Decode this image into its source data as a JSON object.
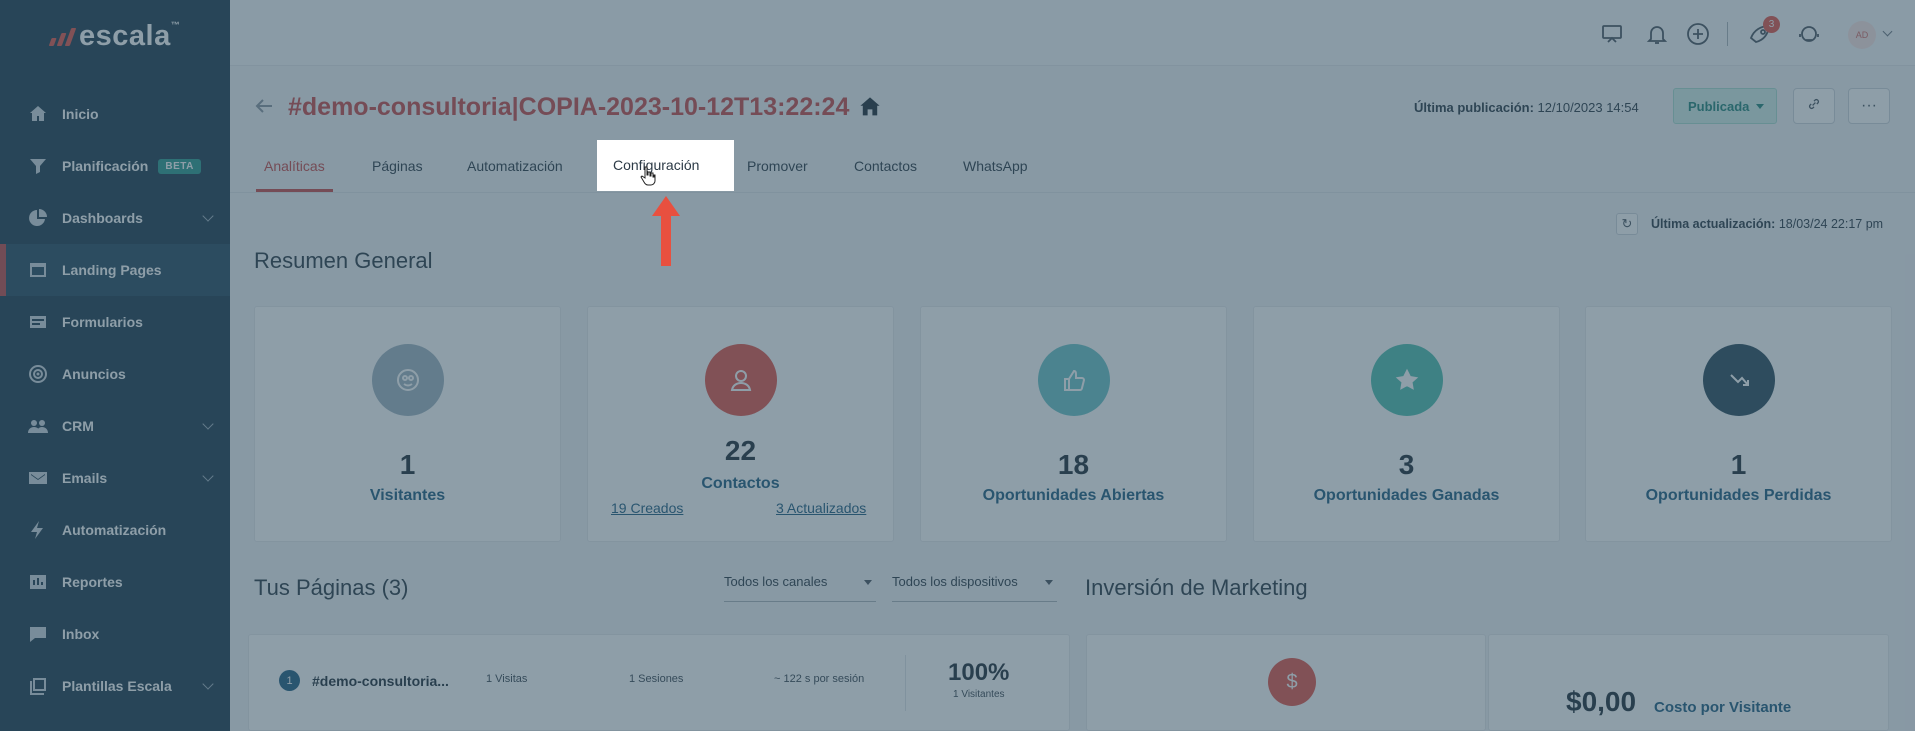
{
  "brand": {
    "name": "escala",
    "mark": "™"
  },
  "sidebar": {
    "items": [
      {
        "label": "Inicio",
        "icon": "home-icon"
      },
      {
        "label": "Planificación",
        "icon": "filter-icon",
        "badge": "BETA"
      },
      {
        "label": "Dashboards",
        "icon": "pie-chart-icon",
        "has_chevron": true
      },
      {
        "label": "Landing Pages",
        "icon": "window-icon",
        "active": true
      },
      {
        "label": "Formularios",
        "icon": "form-icon"
      },
      {
        "label": "Anuncios",
        "icon": "target-icon"
      },
      {
        "label": "CRM",
        "icon": "users-icon",
        "has_chevron": true
      },
      {
        "label": "Emails",
        "icon": "mail-icon",
        "has_chevron": true
      },
      {
        "label": "Automatización",
        "icon": "bolt-icon"
      },
      {
        "label": "Reportes",
        "icon": "report-icon"
      },
      {
        "label": "Inbox",
        "icon": "chat-icon"
      },
      {
        "label": "Plantillas Escala",
        "icon": "template-icon",
        "has_chevron": true
      }
    ]
  },
  "topbar": {
    "notification_count": "3",
    "avatar_initials": "AD",
    "icons": [
      "presentation-icon",
      "bell-icon",
      "plus-circle-icon",
      "rocket-icon",
      "support-icon"
    ]
  },
  "header": {
    "title": "#demo-consultoria|COPIA-2023-10-12T13:22:24",
    "last_publish_label": "Última publicación:",
    "last_publish_value": "12/10/2023 14:54",
    "status_button": "Publicada",
    "more_label": "···"
  },
  "tabs": [
    {
      "label": "Analíticas",
      "active": true
    },
    {
      "label": "Páginas"
    },
    {
      "label": "Automatización"
    },
    {
      "label": "Configuración",
      "highlighted": true
    },
    {
      "label": "Promover"
    },
    {
      "label": "Contactos"
    },
    {
      "label": "WhatsApp"
    }
  ],
  "update": {
    "label": "Última actualización:",
    "value": "18/03/24 22:17 pm"
  },
  "summary": {
    "title": "Resumen General",
    "cards": [
      {
        "value": "1",
        "label": "Visitantes",
        "color": "#9fb4c1",
        "icon": "eye-icon"
      },
      {
        "value": "22",
        "label": "Contactos",
        "color": "#e2544b",
        "icon": "user-icon",
        "link_left": "19 Creados",
        "link_right": "3 Actualizados"
      },
      {
        "value": "18",
        "label": "Oportunidades Abiertas",
        "color": "#6cc3c8",
        "icon": "thumbs-up-icon"
      },
      {
        "value": "3",
        "label": "Oportunidades Ganadas",
        "color": "#4fbfb0",
        "icon": "star-icon"
      },
      {
        "value": "1",
        "label": "Oportunidades Perdidas",
        "color": "#2b4a5c",
        "icon": "trend-down-icon"
      }
    ]
  },
  "pages": {
    "title": "Tus Páginas (3)",
    "filter_channels": "Todos los canales",
    "filter_devices": "Todos los dispositivos",
    "rows": [
      {
        "index": "1",
        "name": "#demo-consultoria...",
        "visits": "1 Visitas",
        "sessions": "1 Sesiones",
        "time": "~ 122 s por sesión",
        "pct": "100%",
        "pct_sub": "1 Visitantes"
      }
    ]
  },
  "marketing": {
    "title": "Inversión de Marketing",
    "currency_symbol": "$",
    "cost_value": "$0,00",
    "cost_label": "Costo por Visitante"
  },
  "colors": {
    "brand_red": "#c84a4a",
    "sidebar": "#1d3a4e",
    "accent_teal": "#22857a",
    "arrow": "#e8503f"
  }
}
